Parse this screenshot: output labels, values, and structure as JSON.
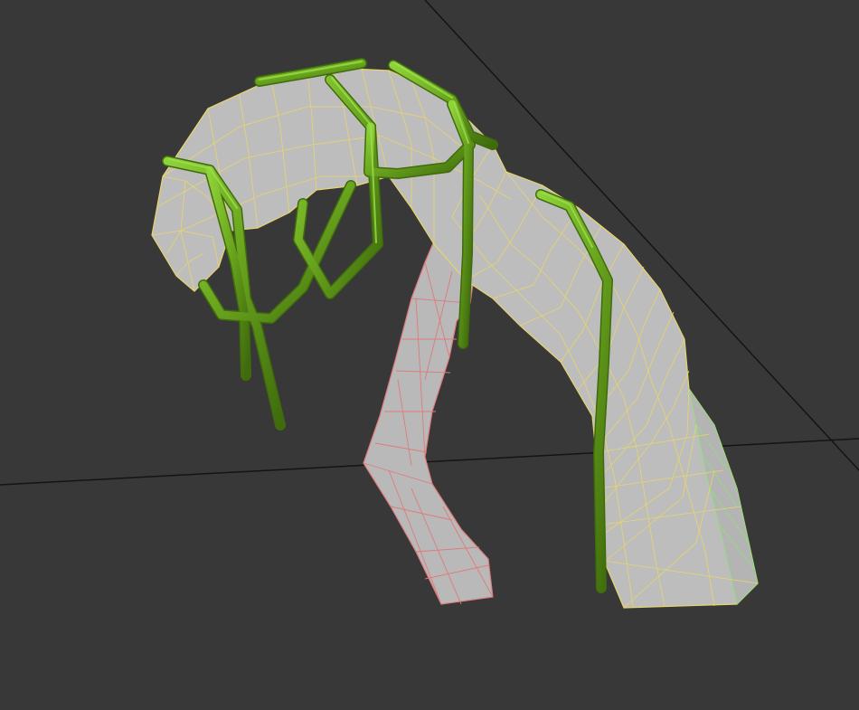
{
  "viewport": {
    "background_color": "#383838",
    "grid_line_color": "#111111",
    "objects": [
      {
        "name": "main-arch-tube",
        "fill": "#bdbdbd",
        "wire_color": "#e8d56a",
        "selected": true
      },
      {
        "name": "inner-bent-tube",
        "fill": "#b9b9b9",
        "wire_color": "#e07a7a",
        "selected": false
      },
      {
        "name": "rear-tube-section",
        "fill": "#b4b4b4",
        "wire_color": "#8fe07a",
        "selected": false
      },
      {
        "name": "green-cage-splines",
        "fill": "#6aa51e",
        "highlight": "#8fd23a",
        "shadow": "#3f6b0c"
      }
    ]
  }
}
